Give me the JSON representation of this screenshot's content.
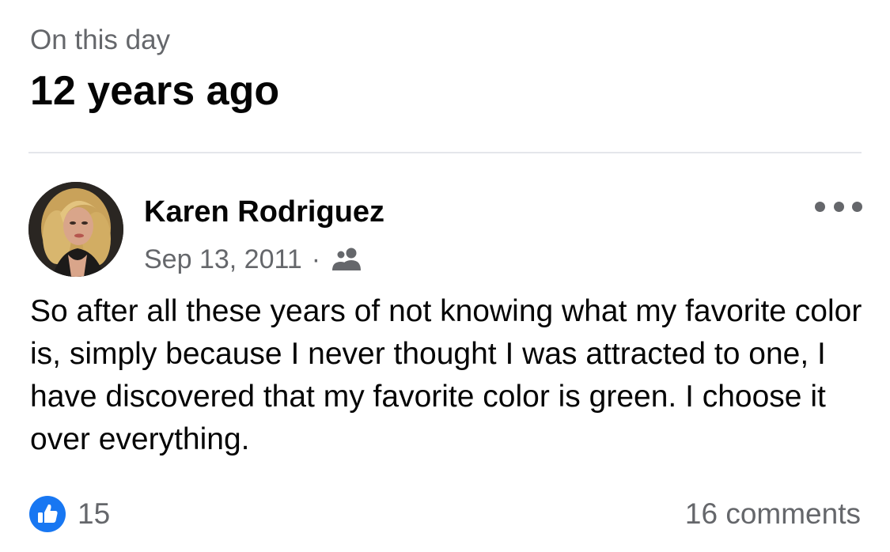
{
  "header": {
    "subtitle": "On this day",
    "title": "12 years ago"
  },
  "post": {
    "author": "Karen Rodriguez",
    "date": "Sep 13, 2011",
    "separator": "·",
    "audience_icon": "friends-icon",
    "more_icon": "more-options-icon",
    "text": "So after all these years of not knowing what my favorite color is, simply because I never thought I was attracted to one, I have discovered that my favorite color is green. I choose it over everything.",
    "likes": "15",
    "like_icon": "like-thumbs-up-icon",
    "comments": "16 comments"
  },
  "colors": {
    "secondary_text": "#65676b",
    "primary_text": "#050505",
    "like_blue": "#1877f2",
    "divider": "#e4e6eb"
  }
}
